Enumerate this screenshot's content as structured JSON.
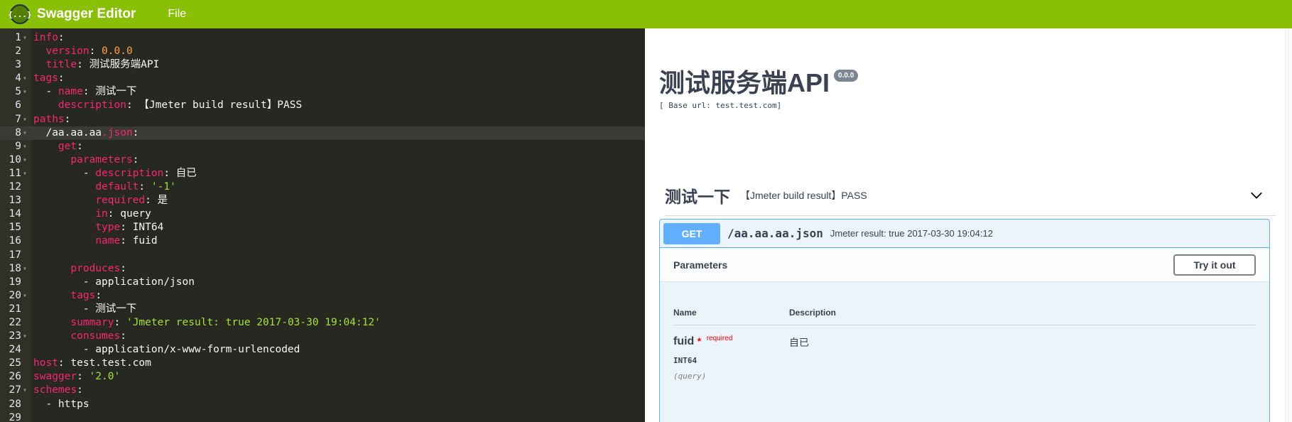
{
  "topbar": {
    "logo_glyph": "{...}",
    "title": "Swagger Editor",
    "menu_file": "File"
  },
  "editor": {
    "lines": [
      {
        "n": "1",
        "fold": true,
        "html": "<span class='k'>info</span><span class='p'>:</span>"
      },
      {
        "n": "2",
        "fold": false,
        "html": "  <span class='k'>version</span><span class='p'>: </span><span class='n'>0.0.0</span>"
      },
      {
        "n": "3",
        "fold": false,
        "html": "  <span class='k'>title</span><span class='p'>: 测试服务端API</span>"
      },
      {
        "n": "4",
        "fold": true,
        "html": "<span class='k'>tags</span><span class='p'>:</span>"
      },
      {
        "n": "5",
        "fold": true,
        "html": "  <span class='p'>- </span><span class='k'>name</span><span class='p'>: 测试一下</span>"
      },
      {
        "n": "6",
        "fold": false,
        "html": "    <span class='k'>description</span><span class='p'>: 【Jmeter build result】PASS</span>"
      },
      {
        "n": "7",
        "fold": true,
        "html": "<span class='k'>paths</span><span class='p'>:</span>"
      },
      {
        "n": "8",
        "fold": true,
        "active": true,
        "html": "  <span class='p'>/aa.aa.aa</span><span class='k'>.json</span><span class='p'>:</span>"
      },
      {
        "n": "9",
        "fold": true,
        "html": "    <span class='k'>get</span><span class='p'>:</span>"
      },
      {
        "n": "10",
        "fold": true,
        "html": "      <span class='k'>parameters</span><span class='p'>:</span>"
      },
      {
        "n": "11",
        "fold": true,
        "html": "        <span class='p'>- </span><span class='k'>description</span><span class='p'>: 自已</span>"
      },
      {
        "n": "12",
        "fold": false,
        "html": "          <span class='k'>default</span><span class='p'>: </span><span class='s'>'-1'</span>"
      },
      {
        "n": "13",
        "fold": false,
        "html": "          <span class='k'>required</span><span class='p'>: 是</span>"
      },
      {
        "n": "14",
        "fold": false,
        "html": "          <span class='k'>in</span><span class='p'>: query</span>"
      },
      {
        "n": "15",
        "fold": false,
        "html": "          <span class='k'>type</span><span class='p'>: INT64</span>"
      },
      {
        "n": "16",
        "fold": false,
        "html": "          <span class='k'>name</span><span class='p'>: fuid</span>"
      },
      {
        "n": "17",
        "fold": false,
        "html": ""
      },
      {
        "n": "18",
        "fold": true,
        "html": "      <span class='k'>produces</span><span class='p'>:</span>"
      },
      {
        "n": "19",
        "fold": false,
        "html": "        <span class='p'>- application/json</span>"
      },
      {
        "n": "20",
        "fold": true,
        "html": "      <span class='k'>tags</span><span class='p'>:</span>"
      },
      {
        "n": "21",
        "fold": false,
        "html": "        <span class='p'>- 测试一下</span>"
      },
      {
        "n": "22",
        "fold": false,
        "html": "      <span class='k'>summary</span><span class='p'>: </span><span class='s'>'Jmeter result: true 2017-03-30 19:04:12'</span>"
      },
      {
        "n": "23",
        "fold": true,
        "html": "      <span class='k'>consumes</span><span class='p'>:</span>"
      },
      {
        "n": "24",
        "fold": false,
        "html": "        <span class='p'>- application/x-www-form-urlencoded</span>"
      },
      {
        "n": "25",
        "fold": false,
        "html": "<span class='k'>host</span><span class='p'>: test.test.com</span>"
      },
      {
        "n": "26",
        "fold": false,
        "html": "<span class='k'>swagger</span><span class='p'>: </span><span class='s'>'2.0'</span>"
      },
      {
        "n": "27",
        "fold": true,
        "html": "<span class='k'>schemes</span><span class='p'>:</span>"
      },
      {
        "n": "28",
        "fold": false,
        "html": "  <span class='p'>- https</span>"
      },
      {
        "n": "29",
        "fold": false,
        "html": ""
      }
    ]
  },
  "preview": {
    "title": "测试服务端API",
    "version": "0.0.0",
    "base_url": "[ Base url: test.test.com]",
    "tag": {
      "name": "测试一下",
      "description": "【Jmeter build result】PASS"
    },
    "operation": {
      "method": "GET",
      "path": "/aa.aa.aa.json",
      "summary": "Jmeter result: true 2017-03-30 19:04:12",
      "params_label": "Parameters",
      "try_label": "Try it out",
      "col_name": "Name",
      "col_desc": "Description",
      "param": {
        "name": "fuid",
        "star": "*",
        "required": "required",
        "type": "INT64",
        "in": "(query)",
        "description": "自已"
      }
    }
  },
  "colors": {
    "topbar": "#89bf04",
    "editor_bg": "#272822",
    "get_method": "#61affe",
    "key": "#f92672",
    "number": "#ff9f49",
    "string": "#a6e22e"
  }
}
